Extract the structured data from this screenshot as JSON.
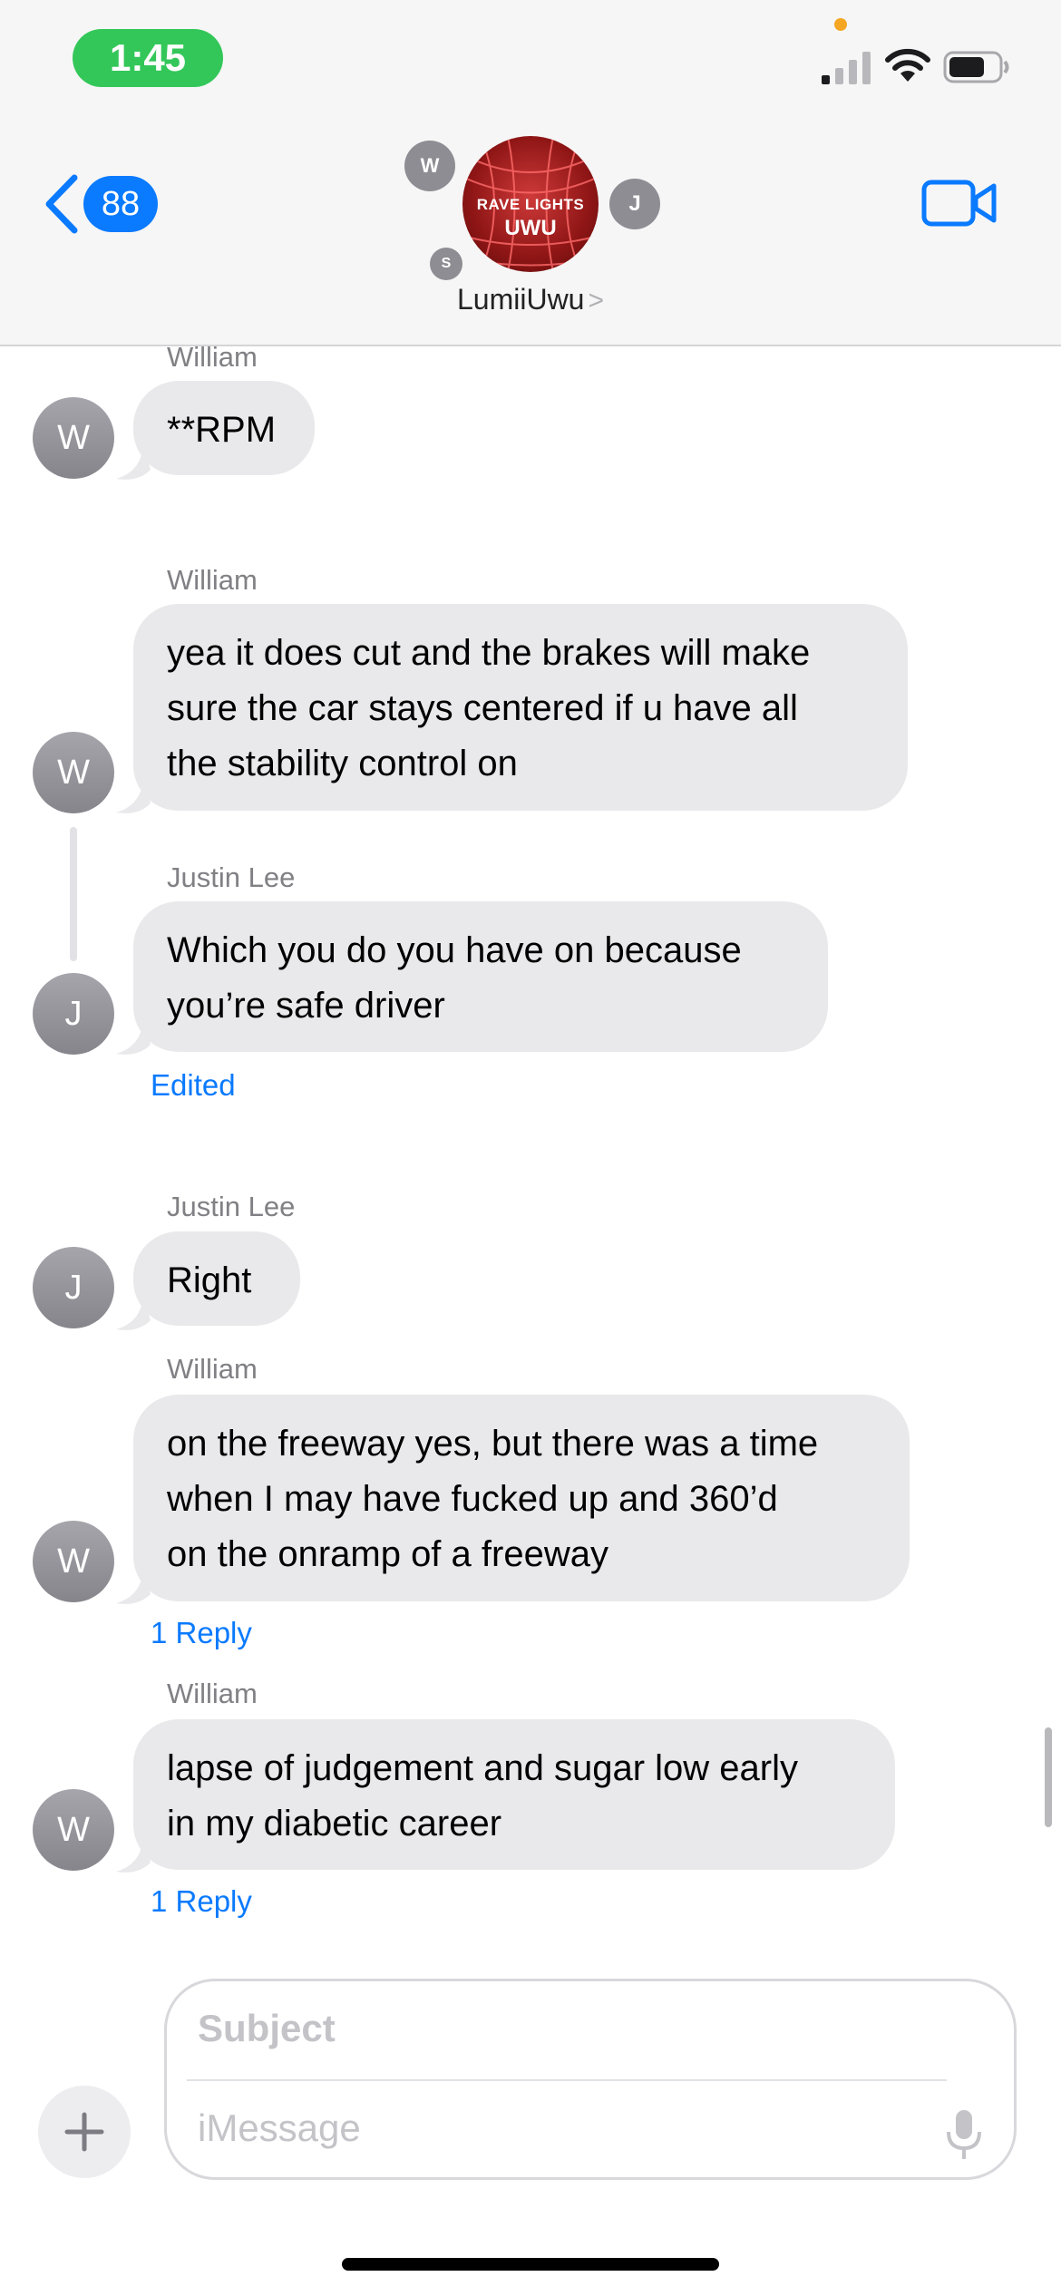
{
  "status_bar": {
    "time": "1:45"
  },
  "header": {
    "back_badge": "88",
    "group_name": "LumiiUwu",
    "chevron": ">",
    "avatar_line1": "RAVE LIGHTS",
    "avatar_line2": "UWU",
    "member_initials": [
      "W",
      "J",
      "S"
    ]
  },
  "messages": [
    {
      "sender": "William",
      "initial": "W",
      "text": "**RPM"
    },
    {
      "sender": "William",
      "initial": "W",
      "lines": [
        "yea it does cut and the brakes will make",
        "sure the car stays centered if u have all",
        "the stability control on"
      ]
    },
    {
      "sender": "Justin Lee",
      "initial": "J",
      "lines": [
        "Which you do you have on because",
        "you’re safe driver"
      ],
      "meta": "Edited"
    },
    {
      "sender": "Justin Lee",
      "initial": "J",
      "text": "Right"
    },
    {
      "sender": "William",
      "initial": "W",
      "lines": [
        "on the freeway yes, but there was a time",
        "when I may have fucked up and 360’d",
        "on the onramp of a freeway"
      ],
      "meta": "1 Reply"
    },
    {
      "sender": "William",
      "initial": "W",
      "lines": [
        "lapse of judgement and sugar low early",
        "in my diabetic career"
      ],
      "meta": "1 Reply"
    }
  ],
  "composer": {
    "subject_placeholder": "Subject",
    "message_placeholder": "iMessage",
    "plus_symbol": "+"
  },
  "colors": {
    "accent": "#0a7aff",
    "time_pill": "#33c759",
    "bubble": "#e9e9eb"
  }
}
